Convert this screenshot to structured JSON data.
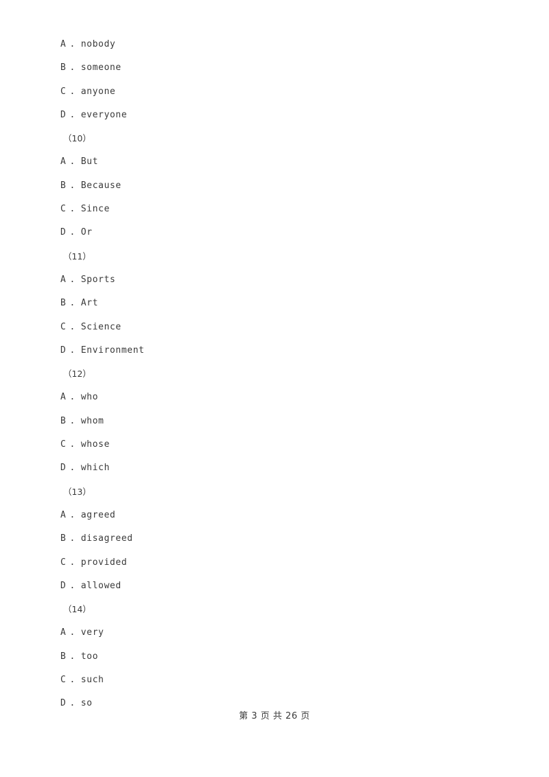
{
  "document": {
    "background_color": "#ffffff",
    "text_color": "#3a3a3a"
  },
  "blocks": [
    {
      "number_label": null,
      "options": [
        {
          "letter": "A",
          "separator": ".",
          "text": "nobody"
        },
        {
          "letter": "B",
          "separator": ".",
          "text": "someone"
        },
        {
          "letter": "C",
          "separator": ".",
          "text": "anyone"
        },
        {
          "letter": "D",
          "separator": ".",
          "text": "everyone"
        }
      ]
    },
    {
      "number_label": "（10）",
      "options": [
        {
          "letter": "A",
          "separator": ".",
          "text": "But"
        },
        {
          "letter": "B",
          "separator": ".",
          "text": "Because"
        },
        {
          "letter": "C",
          "separator": ".",
          "text": "Since"
        },
        {
          "letter": "D",
          "separator": ".",
          "text": "Or"
        }
      ]
    },
    {
      "number_label": "（11）",
      "options": [
        {
          "letter": "A",
          "separator": ".",
          "text": "Sports"
        },
        {
          "letter": "B",
          "separator": ".",
          "text": "Art"
        },
        {
          "letter": "C",
          "separator": ".",
          "text": "Science"
        },
        {
          "letter": "D",
          "separator": ".",
          "text": "Environment"
        }
      ]
    },
    {
      "number_label": "（12）",
      "options": [
        {
          "letter": "A",
          "separator": ".",
          "text": "who"
        },
        {
          "letter": "B",
          "separator": ".",
          "text": "whom"
        },
        {
          "letter": "C",
          "separator": ".",
          "text": "whose"
        },
        {
          "letter": "D",
          "separator": ".",
          "text": "which"
        }
      ]
    },
    {
      "number_label": "（13）",
      "options": [
        {
          "letter": "A",
          "separator": ".",
          "text": "agreed"
        },
        {
          "letter": "B",
          "separator": ".",
          "text": "disagreed"
        },
        {
          "letter": "C",
          "separator": ".",
          "text": "provided"
        },
        {
          "letter": "D",
          "separator": ".",
          "text": "allowed"
        }
      ]
    },
    {
      "number_label": "（14）",
      "options": [
        {
          "letter": "A",
          "separator": ".",
          "text": "very"
        },
        {
          "letter": "B",
          "separator": ".",
          "text": "too"
        },
        {
          "letter": "C",
          "separator": ".",
          "text": "such"
        },
        {
          "letter": "D",
          "separator": ".",
          "text": "so"
        }
      ]
    }
  ],
  "footer": {
    "text": "第 3 页 共 26 页",
    "current_page": "3",
    "total_pages": "26"
  }
}
